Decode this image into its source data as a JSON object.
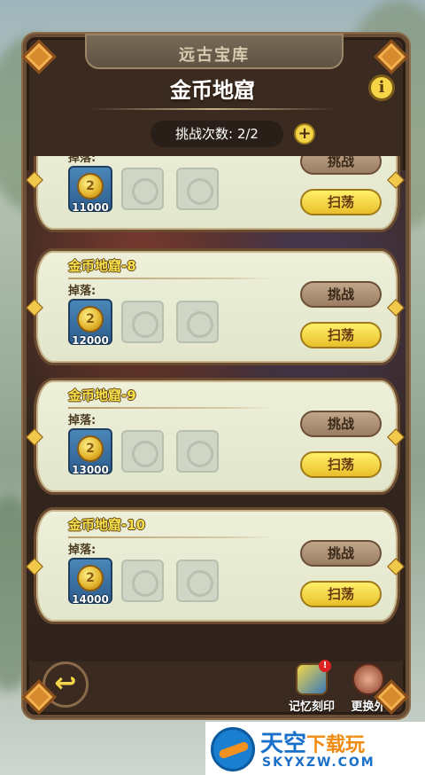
{
  "header": {
    "section_label": "远古宝库",
    "title": "金币地窟",
    "attempts_label": "挑战次数: 2/2",
    "plus_symbol": "+",
    "info_symbol": "i"
  },
  "drop_label": "掉落:",
  "buttons": {
    "challenge": "挑战",
    "sweep": "扫荡"
  },
  "dungeons": [
    {
      "title": "",
      "coin_amount": "11000"
    },
    {
      "title": "金币地窟-8",
      "coin_amount": "12000"
    },
    {
      "title": "金币地窟-9",
      "coin_amount": "13000"
    },
    {
      "title": "金币地窟-10",
      "coin_amount": "14000"
    }
  ],
  "bottom_bar": {
    "back_symbol": "↩",
    "memory_label": "记忆刻印",
    "memory_alert": "!",
    "swap_label": "更换外"
  },
  "watermark": {
    "cn_main": "天空",
    "cn_sub": "下载玩",
    "url": "SKYXZW.COM"
  },
  "colors": {
    "frame": "#3a2a20",
    "card": "#e6e9d0",
    "title_gold": "#f8e24c",
    "sweep_button": "#f2d642",
    "challenge_button": "#b0947a",
    "coin_tile": "#3a72a8"
  }
}
